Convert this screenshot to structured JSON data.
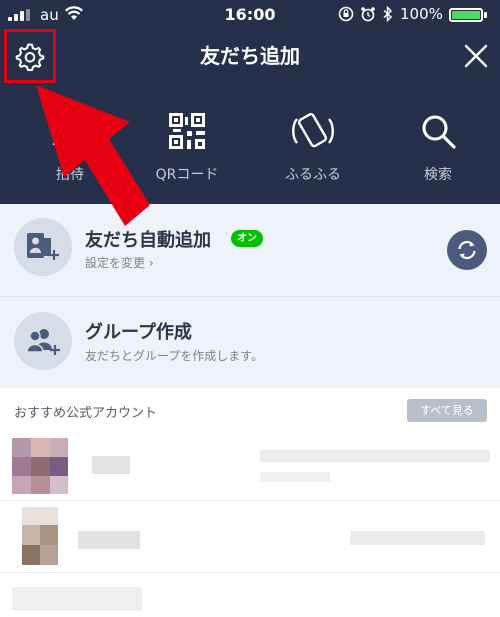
{
  "status_bar": {
    "carrier": "au",
    "time": "16:00",
    "battery_percent": "100%",
    "battery_level": 1.0,
    "battery_color": "#4cd964"
  },
  "header": {
    "title": "友だち追加",
    "settings_icon": "gear-icon",
    "close_icon": "close-icon",
    "background": "#27304a",
    "highlight_color": "#e60012"
  },
  "menu": [
    {
      "label": "招待",
      "icon": "invite-icon"
    },
    {
      "label": "QRコード",
      "icon": "qr-code-icon"
    },
    {
      "label": "ふるふる",
      "icon": "shake-phone-icon"
    },
    {
      "label": "検索",
      "icon": "search-icon"
    }
  ],
  "auto_add": {
    "title": "友だち自動追加",
    "badge": "オン",
    "subtitle": "設定を変更 ›",
    "badge_color": "#00c300"
  },
  "group": {
    "title": "グループ作成",
    "subtitle": "友だちとグループを作成します。"
  },
  "recommended": {
    "title": "おすすめ公式アカウント",
    "see_all": "すべて見る"
  }
}
